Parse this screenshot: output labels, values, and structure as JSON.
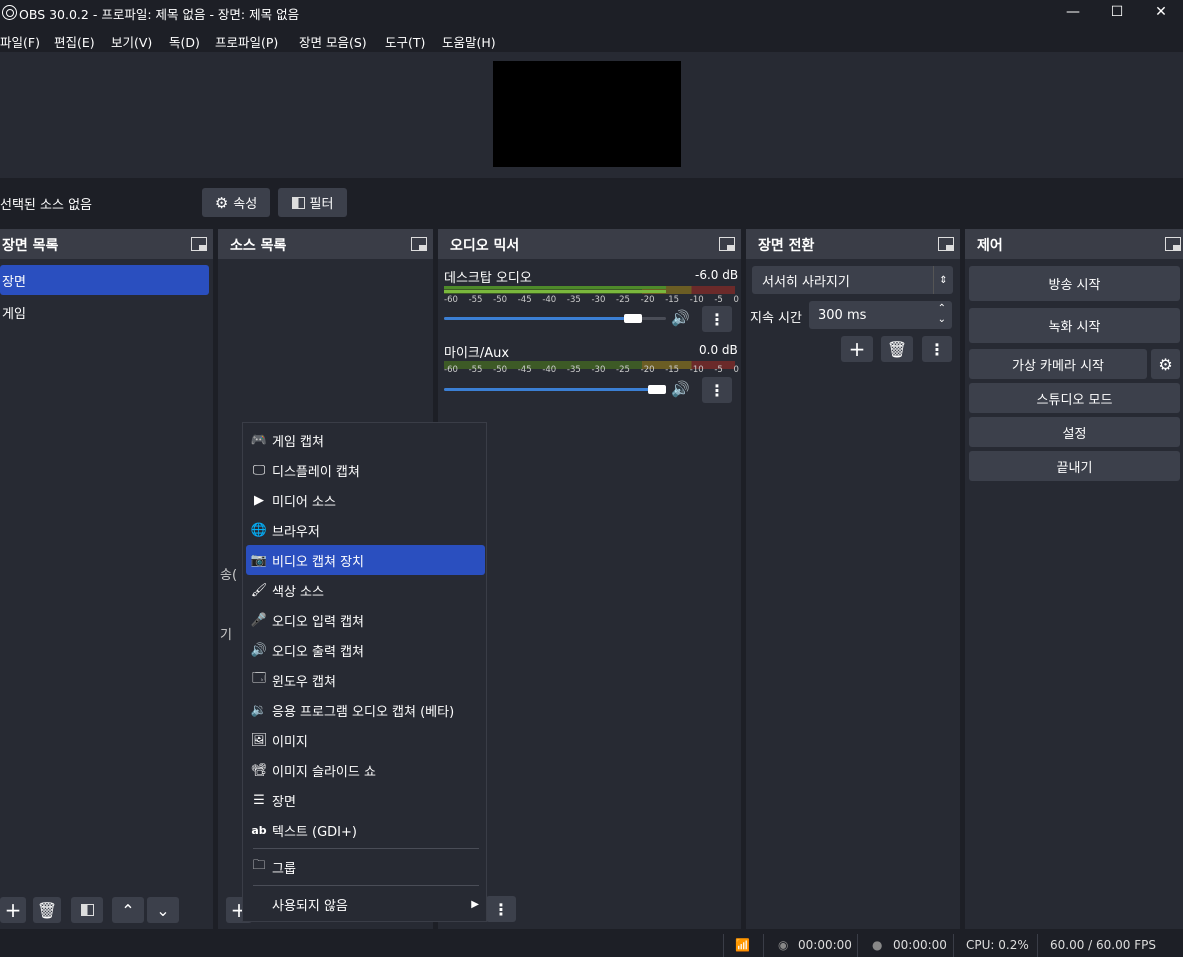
{
  "window": {
    "title": "OBS 30.0.2 - 프로파일: 제목 없음 - 장면: 제목 없음",
    "minimize": "—",
    "maximize": "☐",
    "close": "✕"
  },
  "menu": [
    "파일(F)",
    "편집(E)",
    "보기(V)",
    "독(D)",
    "프로파일(P)",
    "장면 모음(S)",
    "도구(T)",
    "도움말(H)"
  ],
  "source_toolbar": {
    "no_source": "선택된 소스 없음",
    "properties": "속성",
    "filters": "필터"
  },
  "scenes": {
    "title": "장면 목록",
    "items": [
      "장면",
      "게임"
    ],
    "selected": "장면"
  },
  "sources": {
    "title": "소스 목록",
    "partial_1": "송(",
    "partial_2": "기"
  },
  "audio": {
    "title": "오디오 믹서",
    "ticks": [
      "-60",
      "-55",
      "-50",
      "-45",
      "-40",
      "-35",
      "-30",
      "-25",
      "-20",
      "-15",
      "-10",
      "-5",
      "0"
    ],
    "channels": [
      {
        "name": "데스크탑 오디오",
        "db": "-6.0 dB",
        "volume": 0.88
      },
      {
        "name": "마이크/Aux",
        "db": "0.0 dB",
        "volume": 1.0
      }
    ]
  },
  "transitions": {
    "title": "장면 전환",
    "selected": "서서히 사라지기",
    "duration_label": "지속 시간",
    "duration": "300 ms"
  },
  "controls": {
    "title": "제어",
    "start_stream": "방송 시작",
    "start_record": "녹화 시작",
    "virtual_cam": "가상 카메라 시작",
    "studio_mode": "스튜디오 모드",
    "settings": "설정",
    "exit": "끝내기"
  },
  "context_menu": {
    "items": [
      {
        "label": "게임 캡쳐",
        "icon": "gamepad-icon"
      },
      {
        "label": "디스플레이 캡쳐",
        "icon": "monitor-icon"
      },
      {
        "label": "미디어 소스",
        "icon": "play-icon"
      },
      {
        "label": "브라우저",
        "icon": "globe-icon"
      },
      {
        "label": "비디오 캡쳐 장치",
        "icon": "camera-icon"
      },
      {
        "label": "색상 소스",
        "icon": "brush-icon"
      },
      {
        "label": "오디오 입력 캡쳐",
        "icon": "microphone-icon"
      },
      {
        "label": "오디오 출력 캡쳐",
        "icon": "speaker-icon"
      },
      {
        "label": "윈도우 캡쳐",
        "icon": "window-icon"
      },
      {
        "label": "응용 프로그램 오디오 캡쳐 (베타)",
        "icon": "app-audio-icon"
      },
      {
        "label": "이미지",
        "icon": "image-icon"
      },
      {
        "label": "이미지 슬라이드 쇼",
        "icon": "slideshow-icon"
      },
      {
        "label": "장면",
        "icon": "list-icon"
      },
      {
        "label": "텍스트 (GDI+)",
        "icon": "text-icon"
      }
    ],
    "group": "그룹",
    "deprecated": "사용되지 않음",
    "selected": "비디오 캡쳐 장치"
  },
  "status": {
    "stream_time": "00:00:00",
    "record_time": "00:00:00",
    "cpu": "CPU: 0.2%",
    "fps": "60.00 / 60.00 FPS"
  }
}
